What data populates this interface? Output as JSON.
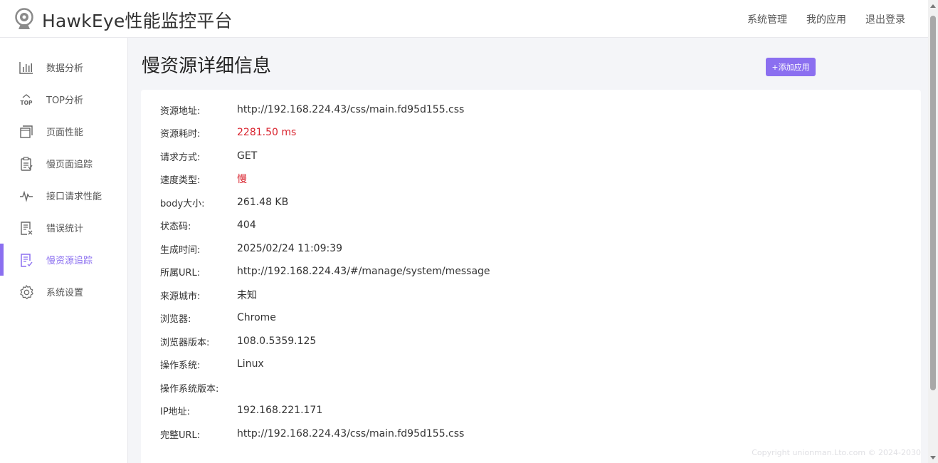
{
  "header": {
    "title": "HawkEye性能监控平台",
    "logo_icon": "webcam-icon",
    "nav": [
      "系统管理",
      "我的应用",
      "退出登录"
    ]
  },
  "sidebar": {
    "active_color": "#8b6ff0",
    "items": [
      {
        "label": "数据分析",
        "icon": "bar-chart-icon",
        "active": false
      },
      {
        "label": "TOP分析",
        "icon": "top-icon",
        "active": false
      },
      {
        "label": "页面性能",
        "icon": "pages-icon",
        "active": false
      },
      {
        "label": "慢页面追踪",
        "icon": "clipboard-icon",
        "active": false
      },
      {
        "label": "接口请求性能",
        "icon": "pulse-icon",
        "active": false
      },
      {
        "label": "错误统计",
        "icon": "error-doc-icon",
        "active": false
      },
      {
        "label": "慢资源追踪",
        "icon": "doc-list-icon",
        "active": true
      },
      {
        "label": "系统设置",
        "icon": "gear-icon",
        "active": false
      }
    ]
  },
  "main": {
    "title": "慢资源详细信息",
    "add_button": "+添加应用",
    "details": [
      {
        "key": "资源地址:",
        "value": "http://192.168.224.43/css/main.fd95d155.css",
        "highlight": false
      },
      {
        "key": "资源耗时:",
        "value": "2281.50 ms",
        "highlight": true
      },
      {
        "key": "请求方式:",
        "value": "GET",
        "highlight": false
      },
      {
        "key": "速度类型:",
        "value": "慢",
        "highlight": true
      },
      {
        "key": "body大小:",
        "value": "261.48 KB",
        "highlight": false
      },
      {
        "key": "状态码:",
        "value": "404",
        "highlight": false
      },
      {
        "key": "生成时间:",
        "value": "2025/02/24 11:09:39",
        "highlight": false
      },
      {
        "key": "所属URL:",
        "value": "http://192.168.224.43/#/manage/system/message",
        "highlight": false
      },
      {
        "key": "来源城市:",
        "value": "未知",
        "highlight": false
      },
      {
        "key": "浏览器:",
        "value": "Chrome",
        "highlight": false
      },
      {
        "key": "浏览器版本:",
        "value": "108.0.5359.125",
        "highlight": false
      },
      {
        "key": "操作系统:",
        "value": "Linux",
        "highlight": false
      },
      {
        "key": "操作系统版本:",
        "value": "",
        "highlight": false
      },
      {
        "key": "IP地址:",
        "value": "192.168.221.171",
        "highlight": false
      },
      {
        "key": "完整URL:",
        "value": "http://192.168.224.43/css/main.fd95d155.css",
        "highlight": false
      }
    ]
  },
  "footer": "Copyright unionman.Lto.com © 2024-2030",
  "colors": {
    "accent": "#8b6ff0",
    "warning_text": "#d9232e"
  }
}
